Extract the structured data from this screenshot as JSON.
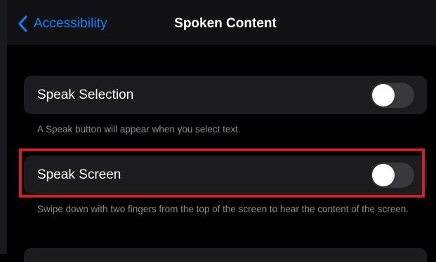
{
  "colors": {
    "accent": "#0a84ff",
    "highlight": "#d0202a",
    "toggle_off": "#39393d"
  },
  "nav": {
    "back_label": "Accessibility",
    "back_icon": "chevron-left-icon",
    "title": "Spoken Content"
  },
  "settings": [
    {
      "label": "Speak Selection",
      "enabled": false,
      "footnote": "A Speak button will appear when you select text."
    },
    {
      "label": "Speak Screen",
      "enabled": false,
      "footnote": "Swipe down with two fingers from the top of the screen to hear the content of the screen."
    }
  ]
}
